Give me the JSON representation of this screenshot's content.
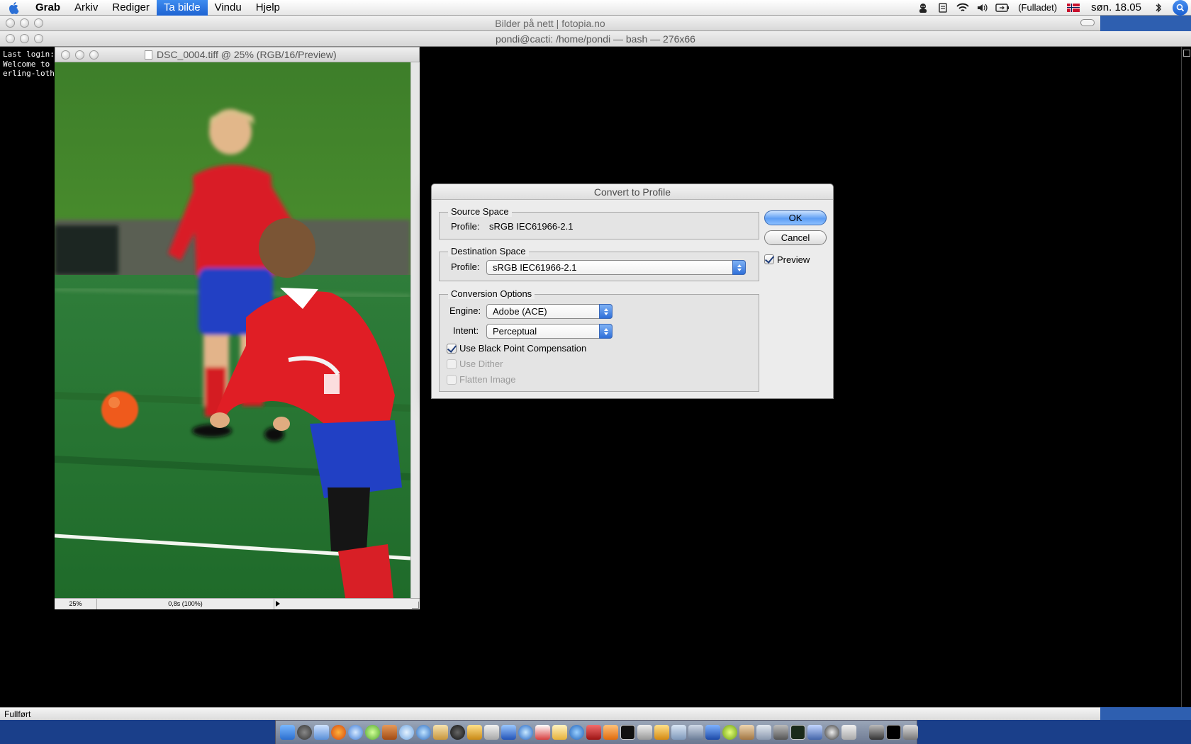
{
  "menubar": {
    "app_name": "Grab",
    "items": [
      "Arkiv",
      "Rediger",
      "Ta bilde",
      "Vindu",
      "Hjelp"
    ],
    "active_item": "Ta bilde",
    "battery_text": "(Fulladet)",
    "clock": "søn. 18.05",
    "status_icons": [
      "spy-icon",
      "sync-icon",
      "wifi-icon",
      "volume-icon",
      "battery-icon",
      "flag-icon",
      "bluetooth-icon",
      "spotlight-icon"
    ]
  },
  "browser": {
    "title": "Bilder på nett | fotopia.no",
    "status": "Fullført"
  },
  "terminal": {
    "title": "pondi@cacti: /home/pondi — bash — 276x66",
    "lines": [
      "Last login: ",
      "Welcome to D",
      "erling-lothe"
    ]
  },
  "photoshop": {
    "window_title": "DSC_0004.tiff @ 25% (RGB/16/Preview)",
    "zoom": "25%",
    "info": "0,8s (100%)"
  },
  "dialog": {
    "title": "Convert to Profile",
    "source_space": {
      "legend": "Source Space",
      "profile_label": "Profile:",
      "profile_value": "sRGB IEC61966-2.1"
    },
    "destination_space": {
      "legend": "Destination Space",
      "profile_label": "Profile:",
      "profile_value": "sRGB IEC61966-2.1"
    },
    "conversion_options": {
      "legend": "Conversion Options",
      "engine_label": "Engine:",
      "engine_value": "Adobe (ACE)",
      "intent_label": "Intent:",
      "intent_value": "Perceptual",
      "black_point_label": "Use Black Point Compensation",
      "black_point_checked": true,
      "dither_label": "Use Dither",
      "dither_checked": false,
      "flatten_label": "Flatten Image",
      "flatten_checked": false
    },
    "ok_label": "OK",
    "cancel_label": "Cancel",
    "preview_label": "Preview",
    "preview_checked": true
  },
  "colors": {
    "accent": "#1e63d2",
    "dock_bg": "#1a3f8a",
    "grass": "#2f7a2e",
    "jersey_red": "#d81f26",
    "shorts_blue": "#1f3fbf"
  }
}
